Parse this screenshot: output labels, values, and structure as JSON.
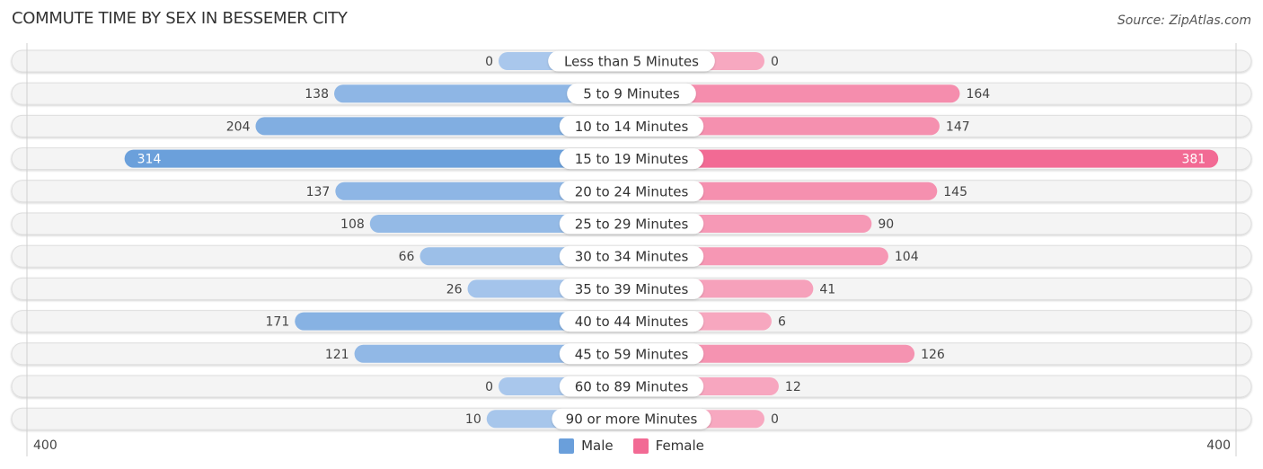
{
  "header": {
    "title": "COMMUTE TIME BY SEX IN BESSEMER CITY",
    "source": "Source: ZipAtlas.com"
  },
  "colors": {
    "male": "#6a9fdb",
    "male_light": "#a9c7ec",
    "female": "#f26a94",
    "female_light": "#f7a8c0",
    "track": "#f4f4f4"
  },
  "chart_data": {
    "type": "bar",
    "orientation": "horizontal-diverging",
    "title": "COMMUTE TIME BY SEX IN BESSEMER CITY",
    "categories": [
      "Less than 5 Minutes",
      "5 to 9 Minutes",
      "10 to 14 Minutes",
      "15 to 19 Minutes",
      "20 to 24 Minutes",
      "25 to 29 Minutes",
      "30 to 34 Minutes",
      "35 to 39 Minutes",
      "40 to 44 Minutes",
      "45 to 59 Minutes",
      "60 to 89 Minutes",
      "90 or more Minutes"
    ],
    "series": [
      {
        "name": "Male",
        "side": "left",
        "values": [
          0,
          138,
          204,
          314,
          137,
          108,
          66,
          26,
          171,
          121,
          0,
          10
        ]
      },
      {
        "name": "Female",
        "side": "right",
        "values": [
          0,
          164,
          147,
          381,
          145,
          90,
          104,
          41,
          6,
          126,
          12,
          0
        ]
      }
    ],
    "axis": {
      "min_label": "400",
      "max_label": "400",
      "range": [
        -400,
        400
      ]
    },
    "legend": {
      "position": "bottom-center",
      "entries": [
        "Male",
        "Female"
      ]
    }
  }
}
